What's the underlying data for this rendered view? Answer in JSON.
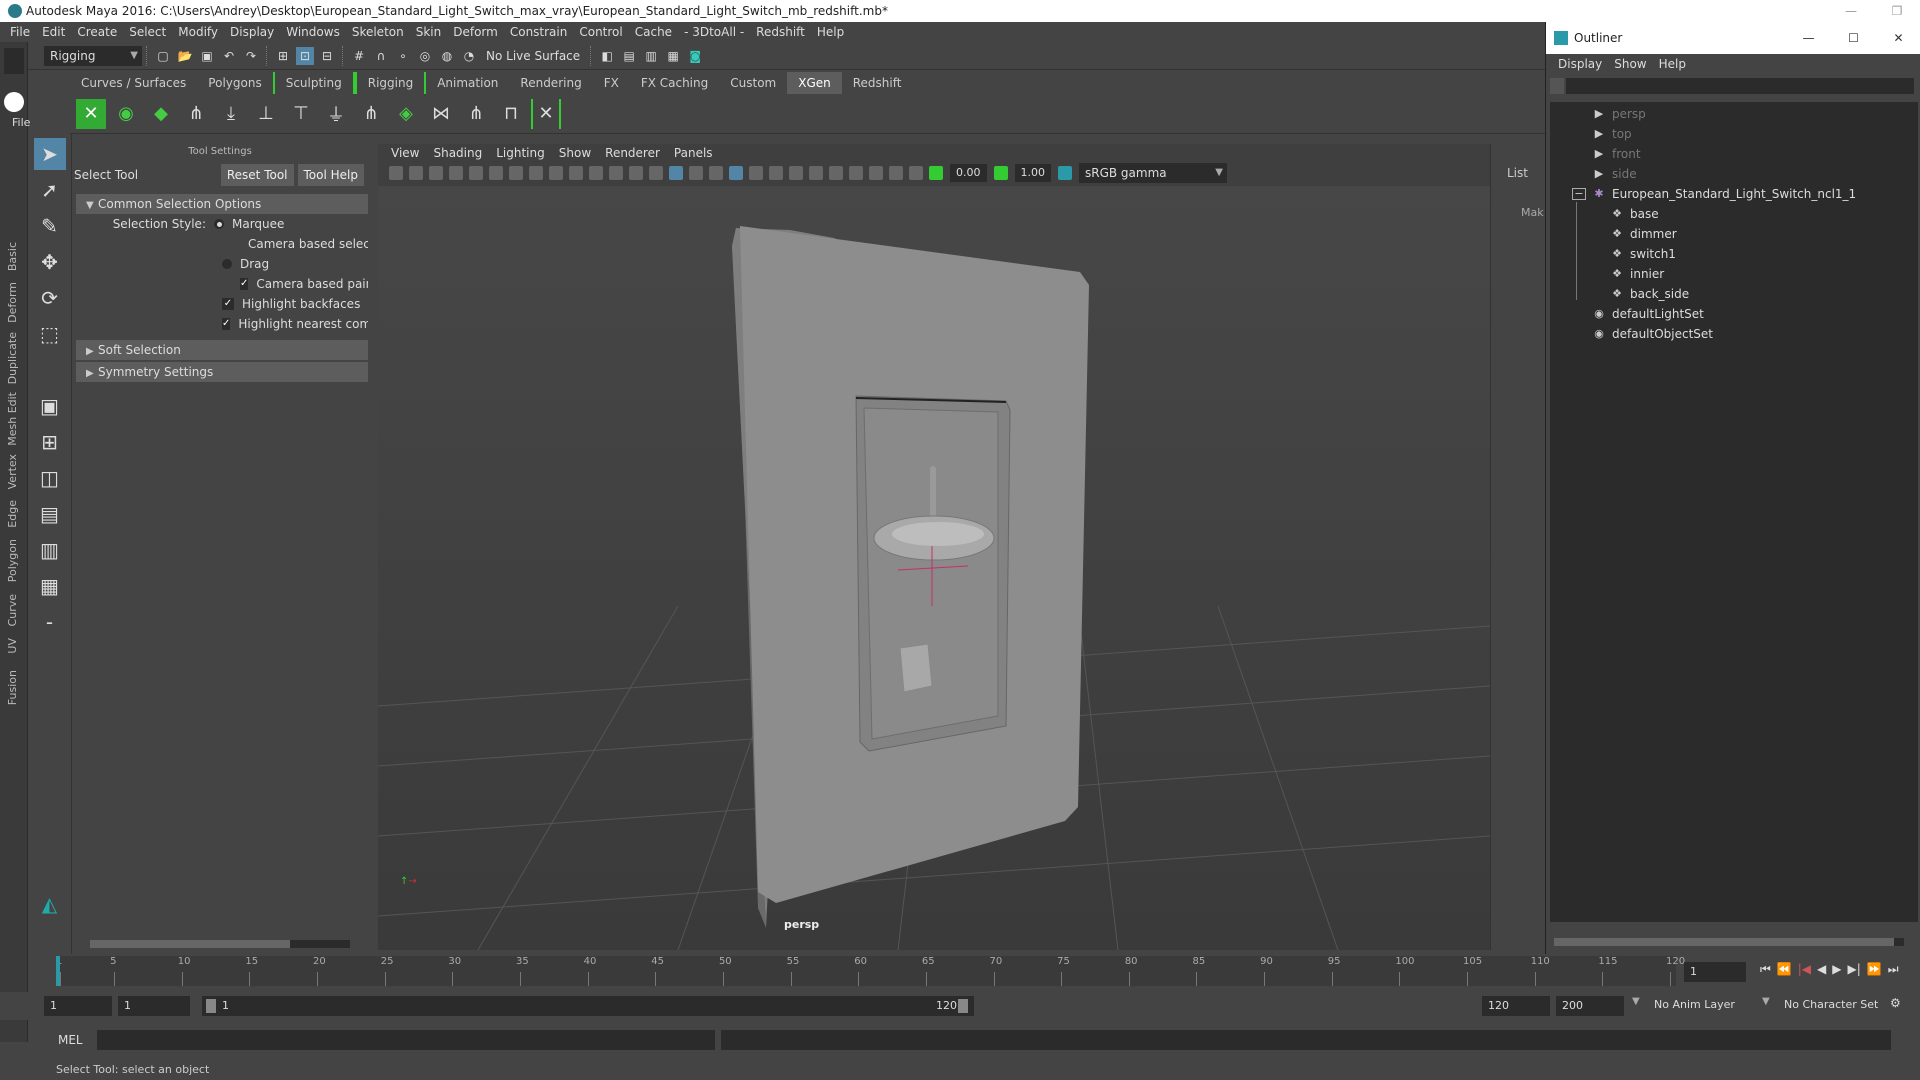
{
  "window": {
    "title": "Autodesk Maya 2016: C:\\Users\\Andrey\\Desktop\\European_Standard_Light_Switch_max_vray\\European_Standard_Light_Switch_mb_redshift.mb*"
  },
  "menubar": [
    "File",
    "Edit",
    "Create",
    "Select",
    "Modify",
    "Display",
    "Windows",
    "Skeleton",
    "Skin",
    "Deform",
    "Constrain",
    "Control",
    "Cache",
    "- 3DtoAll -",
    "Redshift",
    "Help"
  ],
  "statusline": {
    "menuset": "Rigging",
    "live_surface": "No Live Surface"
  },
  "left_strip": {
    "file_label": "File",
    "tabs": [
      "Basic",
      "Deform",
      "Duplicate",
      "Mesh Edit",
      "Vertex",
      "Edge",
      "Polygon",
      "Curve",
      "UV",
      "Fusion"
    ]
  },
  "shelf_tabs": [
    "Curves / Surfaces",
    "Polygons",
    "Sculpting",
    "Rigging",
    "Animation",
    "Rendering",
    "FX",
    "FX Caching",
    "Custom",
    "XGen",
    "Redshift"
  ],
  "shelf_active": "XGen",
  "tool_settings": {
    "header": "Tool Settings",
    "tool_name": "Select Tool",
    "reset_label": "Reset Tool",
    "help_label": "Tool Help",
    "common_section": "Common Selection Options",
    "selection_style_label": "Selection Style:",
    "marquee": "Marquee",
    "camera_based_selection": "Camera based selectio",
    "drag": "Drag",
    "camera_based_paint": "Camera based paint se",
    "highlight_backfaces": "Highlight backfaces",
    "highlight_nearest": "Highlight nearest compor",
    "soft_selection": "Soft Selection",
    "symmetry_settings": "Symmetry Settings"
  },
  "viewport": {
    "menus": [
      "View",
      "Shading",
      "Lighting",
      "Show",
      "Renderer",
      "Panels"
    ],
    "field1": "0.00",
    "field2": "1.00",
    "colorspace": "sRGB gamma",
    "camera_label": "persp"
  },
  "channel_box": {
    "tab": "List",
    "partial": "Mak"
  },
  "outliner": {
    "title": "Outliner",
    "menus": [
      "Display",
      "Show",
      "Help"
    ],
    "items": [
      {
        "label": "persp",
        "dim": true,
        "icon": "camera-icon"
      },
      {
        "label": "top",
        "dim": true,
        "icon": "camera-icon"
      },
      {
        "label": "front",
        "dim": true,
        "icon": "camera-icon"
      },
      {
        "label": "side",
        "dim": true,
        "icon": "camera-icon"
      },
      {
        "label": "European_Standard_Light_Switch_ncl1_1",
        "dim": false,
        "icon": "group-icon"
      },
      {
        "label": "base",
        "dim": false,
        "icon": "mesh-icon"
      },
      {
        "label": "dimmer",
        "dim": false,
        "icon": "mesh-icon"
      },
      {
        "label": "switch1",
        "dim": false,
        "icon": "mesh-icon"
      },
      {
        "label": "innier",
        "dim": false,
        "icon": "mesh-icon"
      },
      {
        "label": "back_side",
        "dim": false,
        "icon": "mesh-icon"
      },
      {
        "label": "defaultLightSet",
        "dim": false,
        "icon": "set-icon"
      },
      {
        "label": "defaultObjectSet",
        "dim": false,
        "icon": "set-icon"
      }
    ]
  },
  "timeline": {
    "ticks": [
      "1",
      "5",
      "10",
      "15",
      "20",
      "25",
      "30",
      "35",
      "40",
      "45",
      "50",
      "55",
      "60",
      "65",
      "70",
      "75",
      "80",
      "85",
      "90",
      "95",
      "100",
      "105",
      "110",
      "115",
      "120"
    ],
    "current_frame": "1"
  },
  "range": {
    "start": "1",
    "playback_start": "1",
    "slider_start": "1",
    "slider_end": "120",
    "playback_end": "120",
    "end": "200",
    "anim_layer": "No Anim Layer",
    "character_set": "No Character Set"
  },
  "command": {
    "language": "MEL"
  },
  "help_line": "Select Tool: select an object"
}
